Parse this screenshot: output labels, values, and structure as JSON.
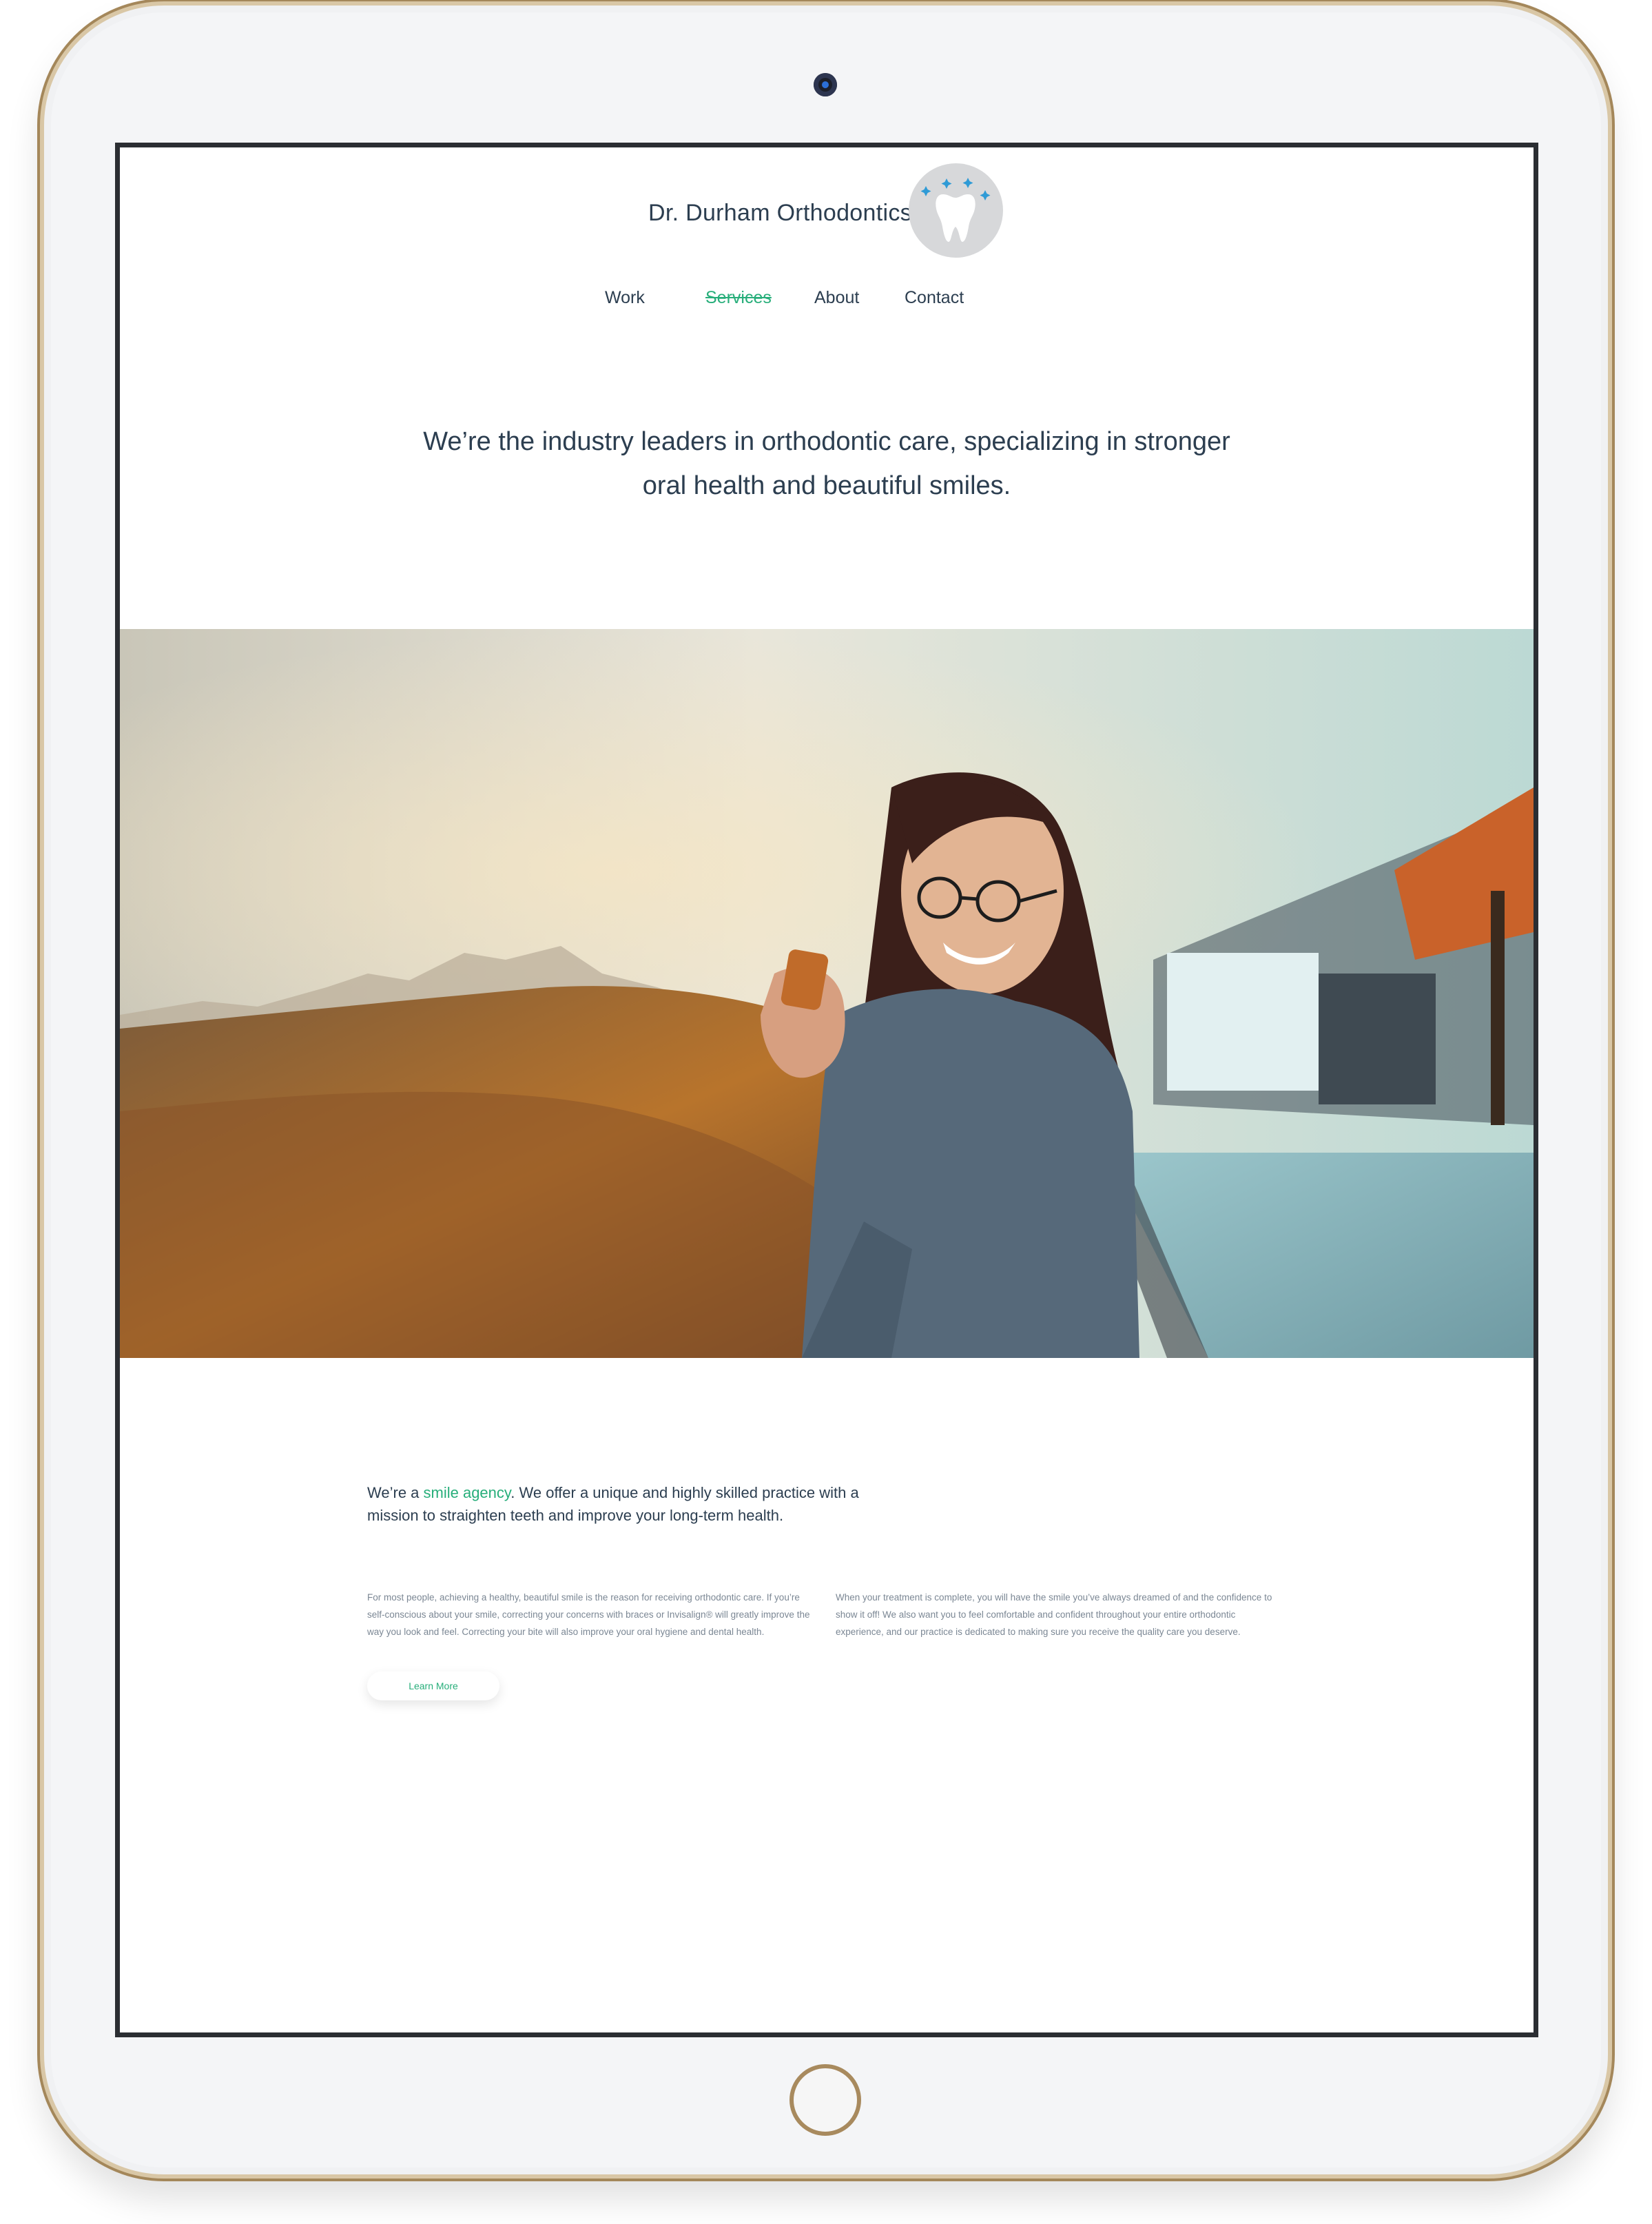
{
  "header": {
    "brand": "Dr. Durham Orthodontics",
    "logo_icon": "tooth-sparkle-icon"
  },
  "nav": {
    "items": [
      {
        "label": "Work"
      },
      {
        "label": "Services",
        "active": true
      },
      {
        "label": "About"
      },
      {
        "label": "Contact"
      }
    ]
  },
  "hero": {
    "tagline_line1": "We’re the industry leaders in orthodontic care, specializing in stronger",
    "tagline_line2": "oral health and beautiful smiles.",
    "image": "smiling-woman-with-phone-photo"
  },
  "intro": {
    "prefix": "We’re a ",
    "highlight": "smile agency",
    "suffix": ". We offer a unique and highly skilled practice with a mission to straighten teeth and improve your long-term health."
  },
  "columns": {
    "left": "For most people, achieving a healthy, beautiful smile is the reason for receiving orthodontic care. If you’re self-conscious about your smile, correcting your concerns with braces or Invisalign® will greatly improve the way you look and feel. Correcting your bite will also improve your oral hygiene and dental health.",
    "right": "When your treatment is complete, you will have the smile you’ve always dreamed of and the confidence to show it off! We also want you to feel comfortable and confident throughout your entire orthodontic experience, and our practice is dedicated to making sure you receive the quality care you deserve."
  },
  "cta": {
    "label": "Learn More"
  },
  "colors": {
    "accent": "#27ae7a",
    "text": "#2c3e50",
    "muted": "#7b8794",
    "bezel_gold": "#a88a5e"
  }
}
